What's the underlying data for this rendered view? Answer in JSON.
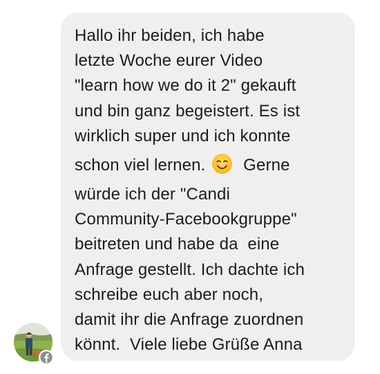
{
  "message": {
    "lines": [
      "Hallo ihr beiden, ich habe",
      "letzte Woche eurer Video",
      "\"learn how we do it 2\" gekauft",
      "und bin ganz begeistert. Es ist",
      "wirklich super und ich konnte",
      "schon viel lernen.",
      "Gerne",
      "würde ich der \"Candi",
      "Community-Facebookgruppe\"",
      "beitreten und habe da  eine",
      "Anfrage gestellt. Ich dachte ich",
      "schreibe euch aber noch,",
      "damit ihr die Anfrage zuordnen",
      "könnt.  Viele liebe Grüße Anna"
    ],
    "emoji": "smiling-face-icon"
  },
  "sender": {
    "avatar_icon": "profile-photo",
    "badge_icon": "facebook-icon"
  },
  "colors": {
    "bubble": "#efefef",
    "text": "#1c1c1c",
    "badge": "#8a8d91"
  }
}
